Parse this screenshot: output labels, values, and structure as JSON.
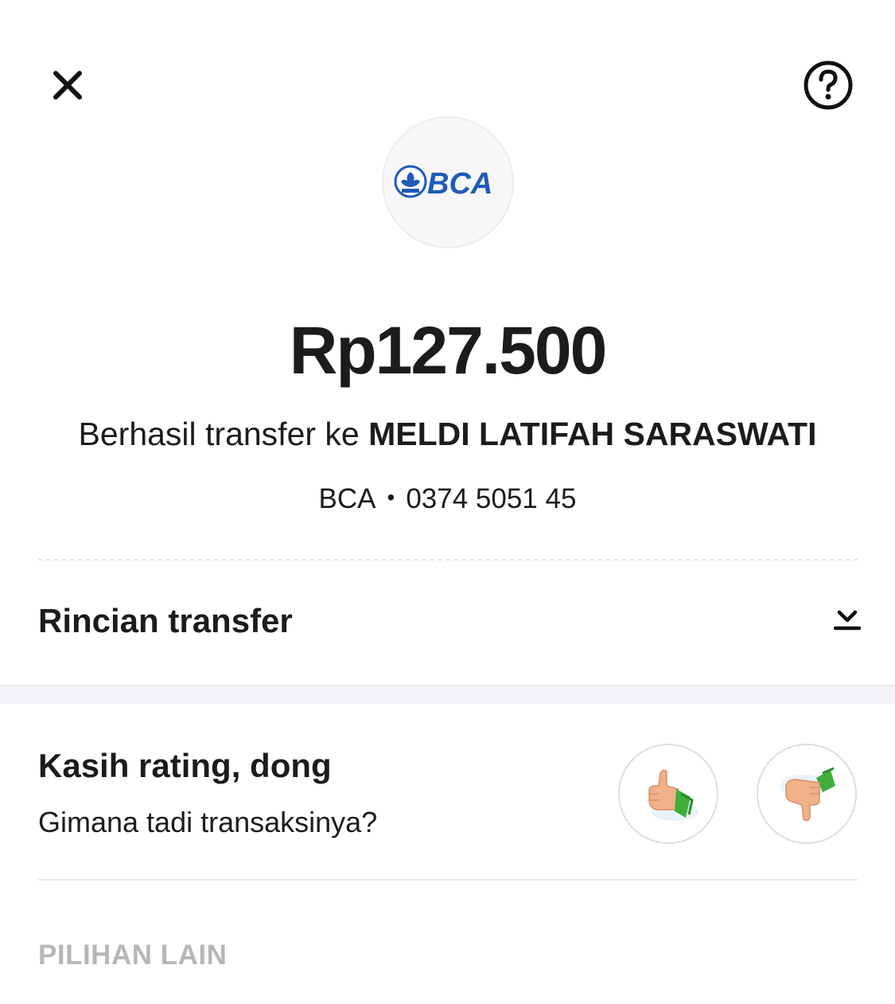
{
  "header": {
    "close_icon": "close-icon",
    "help_icon": "help-icon"
  },
  "bank": {
    "logo_text": "BCA",
    "logo_icon": "bca-logo"
  },
  "transfer": {
    "amount": "Rp127.500",
    "success_prefix": "Berhasil transfer ke ",
    "recipient_name": "MELDI LATIFAH SARASWATI",
    "bank_name": "BCA",
    "separator": "•",
    "account_number": "0374 5051 45"
  },
  "details": {
    "title": "Rincian transfer",
    "icon": "download-icon"
  },
  "rating": {
    "title": "Kasih rating, dong",
    "subtitle": "Gimana tadi transaksinya?",
    "up_icon": "thumbs-up-icon",
    "down_icon": "thumbs-down-icon"
  },
  "other": {
    "label": "PILIHAN LAIN"
  },
  "colors": {
    "text": "#1c1c1c",
    "muted": "#b7b7b7",
    "bca_blue": "#1f5bb8",
    "sleeve_green": "#3fae3b",
    "skin": "#f0b08a"
  }
}
